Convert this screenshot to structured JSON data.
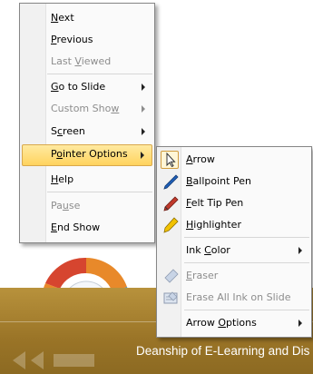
{
  "slide": {
    "footer_text": "Deanship of E-Learning and Dis"
  },
  "context_menu": {
    "items": [
      {
        "label": "Next",
        "mnemonic": "N",
        "rest": "ext",
        "disabled": false
      },
      {
        "label": "Previous",
        "mnemonic": "P",
        "rest": "revious",
        "disabled": false
      },
      {
        "label": "Last Viewed",
        "disabled": true
      },
      {
        "label": "Go to Slide",
        "mnemonic": "G",
        "rest": "o to Slide",
        "submenu": true
      },
      {
        "label": "Custom Show",
        "disabled": true,
        "submenu": true
      },
      {
        "label": "Screen",
        "submenu": true
      },
      {
        "label": "Pointer Options",
        "submenu": true,
        "highlighted": true
      },
      {
        "label": "Help",
        "mnemonic": "H",
        "rest": "elp"
      },
      {
        "label": "Pause",
        "disabled": true
      },
      {
        "label": "End Show",
        "mnemonic": "E",
        "rest": "nd Show"
      }
    ]
  },
  "pointer_submenu": {
    "items": [
      {
        "label": "Arrow",
        "icon": "arrow-cursor-icon",
        "checked": true
      },
      {
        "label": "Ballpoint Pen",
        "icon": "ballpoint-pen-icon"
      },
      {
        "label": "Felt Tip Pen",
        "icon": "felt-tip-pen-icon"
      },
      {
        "label": "Highlighter",
        "icon": "highlighter-icon"
      },
      {
        "label": "Ink Color",
        "submenu": true
      },
      {
        "label": "Eraser",
        "icon": "eraser-icon",
        "disabled": true
      },
      {
        "label": "Erase All Ink on Slide",
        "icon": "erase-all-ink-icon",
        "disabled": true
      },
      {
        "label": "Arrow Options",
        "submenu": true
      }
    ]
  },
  "colors": {
    "highlight": "#ffd35e",
    "band": "#9a7427",
    "ballpoint_pen": "#1f5fb8",
    "felt_tip_pen": "#c0392b",
    "highlighter": "#f2c200"
  }
}
